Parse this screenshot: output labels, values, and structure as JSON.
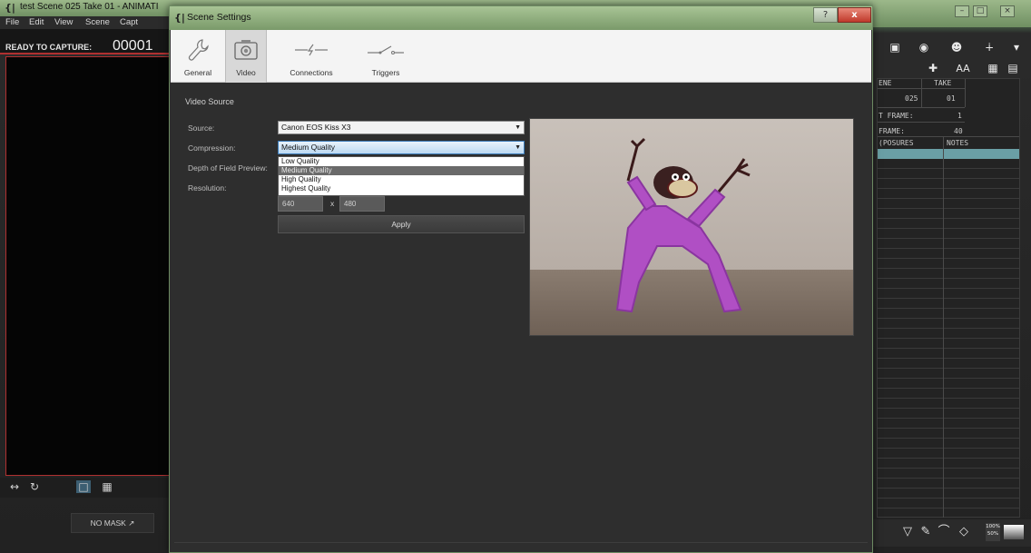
{
  "main_window": {
    "title": "test  Scene 025  Take 01 - ANIMATI",
    "menu": [
      "File",
      "Edit",
      "View",
      "Scene",
      "Capt"
    ],
    "ready_label": "READY TO CAPTURE:",
    "ready_count": "00001",
    "no_mask_label": "NO MASK ↗"
  },
  "dialog": {
    "title": "Scene Settings",
    "help_glyph": "?",
    "close_glyph": "x",
    "tabs": [
      {
        "label": "General",
        "icon": "wrench-icon"
      },
      {
        "label": "Video",
        "icon": "camera-icon"
      },
      {
        "label": "Connections",
        "icon": "connection-icon"
      },
      {
        "label": "Triggers",
        "icon": "switch-icon"
      }
    ],
    "active_tab": "Video",
    "section_title": "Video Source",
    "source_label": "Source:",
    "source_value": "Canon EOS Kiss X3",
    "compression_label": "Compression:",
    "compression_value": "Medium Quality",
    "compression_options": [
      "Low Quality",
      "Medium Quality",
      "High Quality",
      "Highest Quality"
    ],
    "dof_label": "Depth of Field Preview:",
    "resolution_label": "Resolution:",
    "resolution_width": "640",
    "resolution_x": "x",
    "resolution_height": "480",
    "apply_label": "Apply"
  },
  "right_panel": {
    "col_scene": "ENE",
    "col_take": "TAKE",
    "scene_value": "025",
    "take_value": "01",
    "first_frame_label": "T FRAME:",
    "first_frame_value": "1",
    "last_frame_label": "FRAME:",
    "last_frame_value": "40",
    "exposures_label": "(POSURES",
    "notes_label": "NOTES",
    "zoom_top": "100%",
    "zoom_bottom": "50%",
    "aa_label": "AA"
  },
  "colors": {
    "accent_red": "#b03030",
    "highlight_teal": "#6a9fa5",
    "selected_blue": "#3c5e72"
  }
}
